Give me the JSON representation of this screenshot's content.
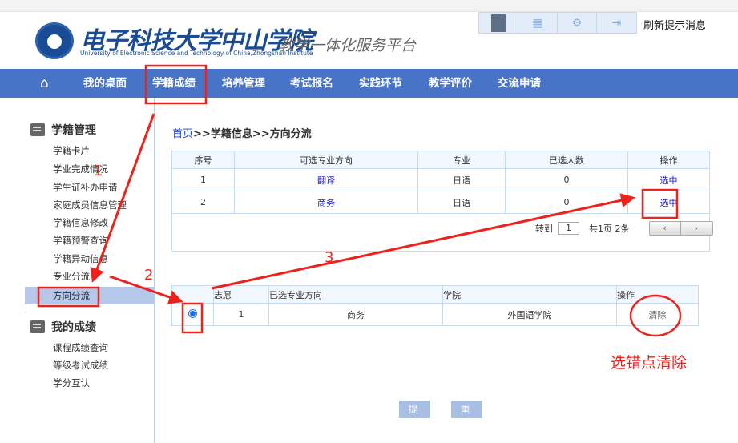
{
  "header": {
    "logo_cn": "电子科技大学中山学院",
    "logo_en": "University of Electronic Science and Technology of China,Zhongshan Institute",
    "platform": "教学一体化服务平台",
    "refresh": "刷新提示消息"
  },
  "nav": {
    "items": [
      "我的桌面",
      "学籍成绩",
      "培养管理",
      "考试报名",
      "实践环节",
      "教学评价",
      "交流申请"
    ]
  },
  "sidebar": {
    "sections": [
      {
        "title": "学籍管理",
        "items": [
          "学籍卡片",
          "学业完成情况",
          "学生证补办申请",
          "家庭成员信息管理",
          "学籍信息修改",
          "学籍预警查询",
          "学籍异动信息",
          "专业分流",
          "方向分流"
        ]
      },
      {
        "title": "我的成绩",
        "items": [
          "课程成绩查询",
          "等级考试成绩",
          "学分互认"
        ]
      }
    ],
    "active": "方向分流"
  },
  "breadcrumb": {
    "home": "首页",
    "sep": ">>",
    "rest": "学籍信息>>方向分流",
    "part1": "学籍信息",
    "part2": "方向分流"
  },
  "table1": {
    "headers": [
      "序号",
      "可选专业方向",
      "专业",
      "已选人数",
      "操作"
    ],
    "rows": [
      {
        "no": "1",
        "direction": "翻译",
        "major": "日语",
        "count": "0",
        "action": "选中"
      },
      {
        "no": "2",
        "direction": "商务",
        "major": "日语",
        "count": "0",
        "action": "选中"
      }
    ]
  },
  "pager": {
    "goto": "转到",
    "page": "1",
    "summary": "共1页 2条",
    "prev": "‹",
    "next": "›"
  },
  "table2": {
    "headers": [
      "",
      "志愿",
      "已选专业方向",
      "学院",
      "操作"
    ],
    "rows": [
      {
        "rank": "1",
        "direction": "商务",
        "college": "外国语学院",
        "action": "清除"
      }
    ]
  },
  "buttons": {
    "submit": "提 交",
    "reset": "重 置"
  },
  "annotations": {
    "step1": "1",
    "step2": "2",
    "step3": "3",
    "note": "选错点清除",
    "color": "#f0201a"
  }
}
